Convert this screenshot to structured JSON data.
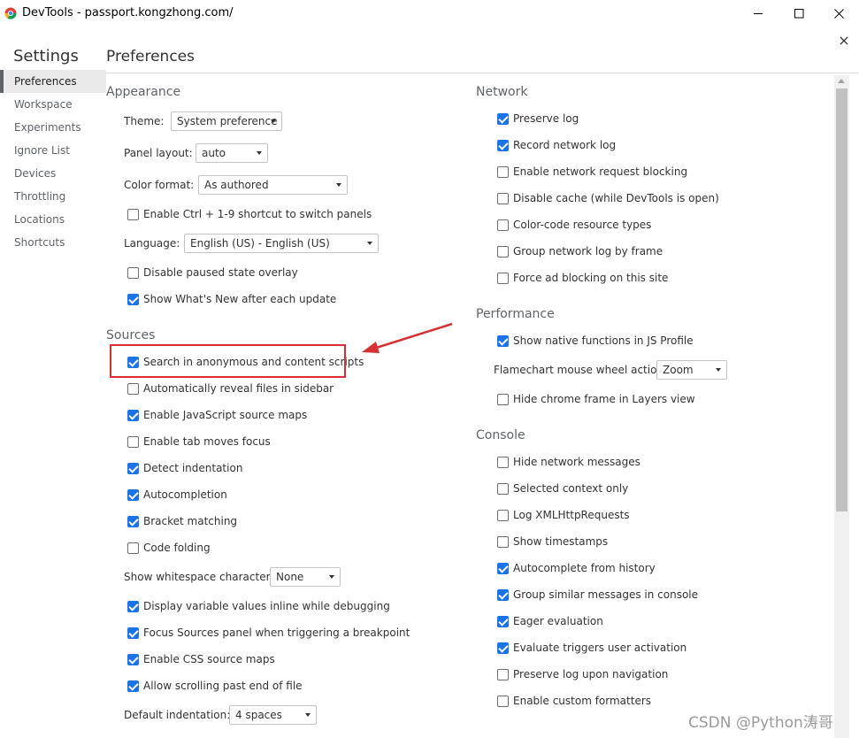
{
  "window": {
    "title": "DevTools - passport.kongzhong.com/"
  },
  "nav": {
    "title": "Settings",
    "items": [
      {
        "label": "Preferences",
        "active": true
      },
      {
        "label": "Workspace"
      },
      {
        "label": "Experiments"
      },
      {
        "label": "Ignore List"
      },
      {
        "label": "Devices"
      },
      {
        "label": "Throttling"
      },
      {
        "label": "Locations"
      },
      {
        "label": "Shortcuts"
      }
    ]
  },
  "page": {
    "title": "Preferences"
  },
  "appearance": {
    "title": "Appearance",
    "theme_label": "Theme:",
    "theme_value": "System preference",
    "panel_layout_label": "Panel layout:",
    "panel_layout_value": "auto",
    "color_format_label": "Color format:",
    "color_format_value": "As authored",
    "ctrl_shortcut": {
      "label": "Enable Ctrl + 1-9 shortcut to switch panels",
      "checked": false
    },
    "language_label": "Language:",
    "language_value": "English (US) - English (US)",
    "paused_overlay": {
      "label": "Disable paused state overlay",
      "checked": false
    },
    "whats_new": {
      "label": "Show What's New after each update",
      "checked": true
    }
  },
  "sources": {
    "title": "Sources",
    "items": [
      {
        "label": "Search in anonymous and content scripts",
        "checked": true
      },
      {
        "label": "Automatically reveal files in sidebar",
        "checked": false
      },
      {
        "label": "Enable JavaScript source maps",
        "checked": true
      },
      {
        "label": "Enable tab moves focus",
        "checked": false
      },
      {
        "label": "Detect indentation",
        "checked": true
      },
      {
        "label": "Autocompletion",
        "checked": true
      },
      {
        "label": "Bracket matching",
        "checked": true
      },
      {
        "label": "Code folding",
        "checked": false
      }
    ],
    "whitespace_label": "Show whitespace characters:",
    "whitespace_value": "None",
    "items2": [
      {
        "label": "Display variable values inline while debugging",
        "checked": true
      },
      {
        "label": "Focus Sources panel when triggering a breakpoint",
        "checked": true
      },
      {
        "label": "Enable CSS source maps",
        "checked": true
      },
      {
        "label": "Allow scrolling past end of file",
        "checked": true
      }
    ],
    "indentation_label": "Default indentation:",
    "indentation_value": "4 spaces"
  },
  "network": {
    "title": "Network",
    "items": [
      {
        "label": "Preserve log",
        "checked": true
      },
      {
        "label": "Record network log",
        "checked": true
      },
      {
        "label": "Enable network request blocking",
        "checked": false
      },
      {
        "label": "Disable cache (while DevTools is open)",
        "checked": false
      },
      {
        "label": "Color-code resource types",
        "checked": false
      },
      {
        "label": "Group network log by frame",
        "checked": false
      },
      {
        "label": "Force ad blocking on this site",
        "checked": false
      }
    ]
  },
  "performance": {
    "title": "Performance",
    "native_functions": {
      "label": "Show native functions in JS Profile",
      "checked": true
    },
    "wheel_label": "Flamechart mouse wheel action:",
    "wheel_value": "Zoom",
    "hide_chrome_frame": {
      "label": "Hide chrome frame in Layers view",
      "checked": false
    }
  },
  "console": {
    "title": "Console",
    "items": [
      {
        "label": "Hide network messages",
        "checked": false
      },
      {
        "label": "Selected context only",
        "checked": false
      },
      {
        "label": "Log XMLHttpRequests",
        "checked": false
      },
      {
        "label": "Show timestamps",
        "checked": false
      },
      {
        "label": "Autocomplete from history",
        "checked": true
      },
      {
        "label": "Group similar messages in console",
        "checked": true
      },
      {
        "label": "Eager evaluation",
        "checked": true
      },
      {
        "label": "Evaluate triggers user activation",
        "checked": true
      },
      {
        "label": "Preserve log upon navigation",
        "checked": false
      },
      {
        "label": "Enable custom formatters",
        "checked": false
      }
    ]
  },
  "watermark": "CSDN @Python涛哥",
  "colors": {
    "accent": "#1a73e8",
    "annotation": "#d63030"
  }
}
